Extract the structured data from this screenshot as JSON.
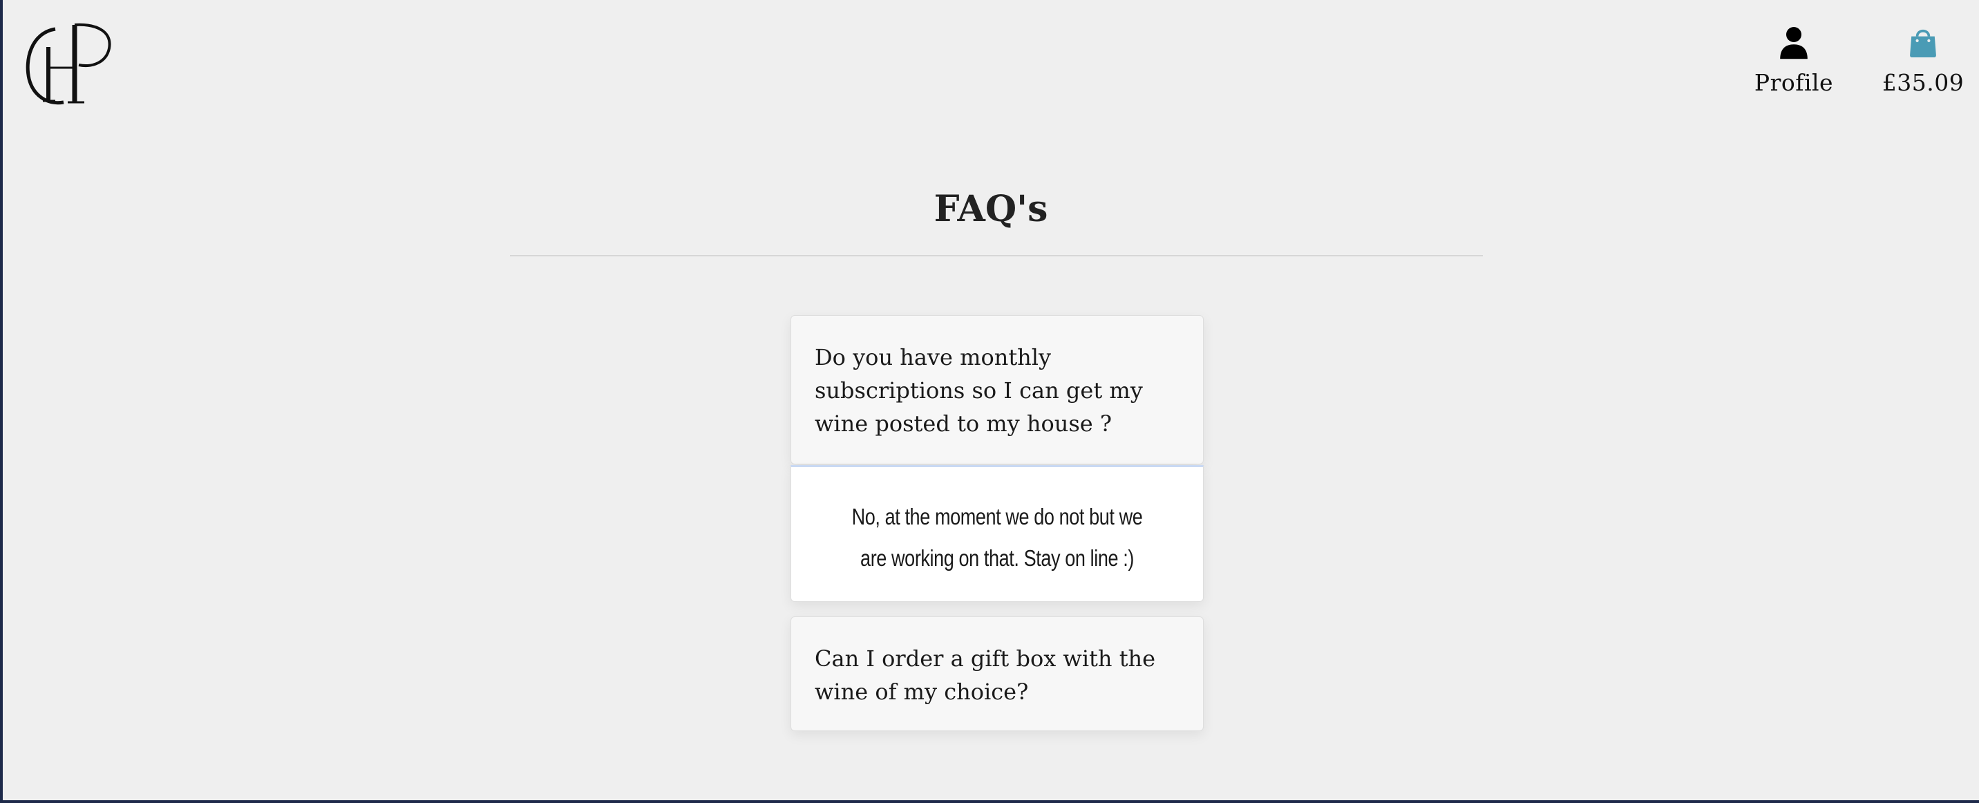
{
  "header": {
    "logo_icon": "monogram-logo",
    "profile": {
      "icon": "person-icon",
      "label": "Profile"
    },
    "cart": {
      "icon": "shopping-bag-icon",
      "total": "£35.09",
      "icon_color": "#4a9bb5"
    }
  },
  "main": {
    "title": "FAQ's",
    "faqs": [
      {
        "question": "Do you have monthly subscriptions so I can get my wine posted to my house ?",
        "answer": "No, at the moment we do not but we are working on that. Stay on line :)",
        "expanded": true
      },
      {
        "question": "Can I order a gift box with the wine of my choice?",
        "answer": "",
        "expanded": false
      }
    ]
  },
  "colors": {
    "page_background": "#efefef",
    "card_background": "#f7f7f7",
    "answer_background": "#ffffff",
    "accent": "#4a9bb5"
  }
}
